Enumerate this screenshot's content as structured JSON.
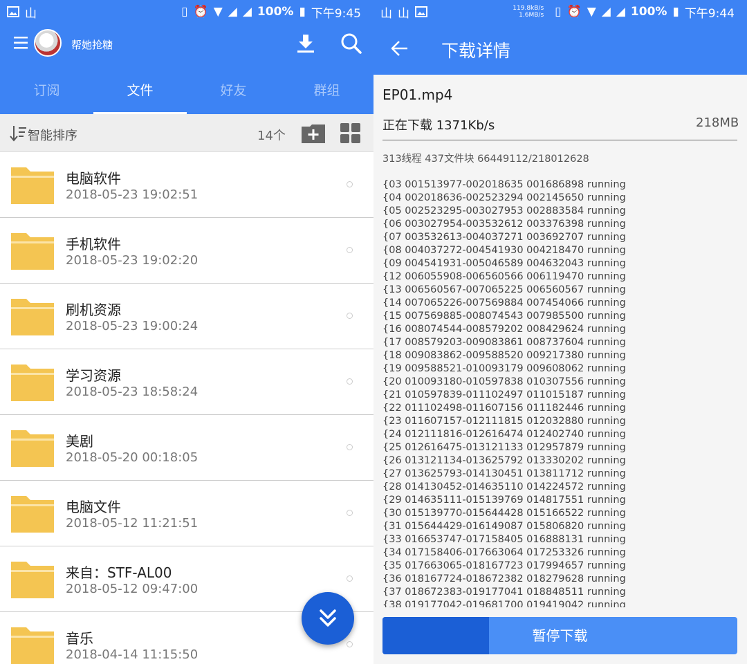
{
  "left": {
    "status": {
      "time": "下午9:45",
      "battery": "100%"
    },
    "user": {
      "name": "帮她抢糖"
    },
    "tabs": [
      {
        "label": "订阅"
      },
      {
        "label": "文件"
      },
      {
        "label": "好友"
      },
      {
        "label": "群组"
      }
    ],
    "sort": {
      "label": "智能排序",
      "count": "14个"
    },
    "files": [
      {
        "name": "电脑软件",
        "date": "2018-05-23 19:02:51"
      },
      {
        "name": "手机软件",
        "date": "2018-05-23 19:02:20"
      },
      {
        "name": "刷机资源",
        "date": "2018-05-23 19:00:24"
      },
      {
        "name": "学习资源",
        "date": "2018-05-23 18:58:24"
      },
      {
        "name": "美剧",
        "date": "2018-05-20 00:18:05"
      },
      {
        "name": "电脑文件",
        "date": "2018-05-12 11:21:51"
      },
      {
        "name": "来自：STF-AL00",
        "date": "2018-05-12 09:47:00"
      },
      {
        "name": "音乐",
        "date": "2018-04-14 11:15:50"
      }
    ],
    "accent": "#3d83f4",
    "folder_color": "#f4c552"
  },
  "right": {
    "status": {
      "net_up": "119.8kB/s",
      "net_down": "1.6MB/s",
      "battery": "100%",
      "time": "下午9:44"
    },
    "title": "下载详情",
    "file": "EP01.mp4",
    "speed": "正在下载 1371Kb/s",
    "size": "218MB",
    "threads": "313线程 437文件块 66449112/218012628",
    "log": [
      "{03 001513977-002018635 001686898 running",
      "{04 002018636-002523294 002145650 running",
      "{05 002523295-003027953 002883584 running",
      "{06 003027954-003532612 003376398 running",
      "{07 003532613-004037271 003692707 running",
      "{08 004037272-004541930 004218470 running",
      "{09 004541931-005046589 004632043 running",
      "{12 006055908-006560566 006119470 running",
      "{13 006560567-007065225 006560567 running",
      "{14 007065226-007569884 007454066 running",
      "{15 007569885-008074543 007985500 running",
      "{16 008074544-008579202 008429624 running",
      "{17 008579203-009083861 008737604 running",
      "{18 009083862-009588520 009217380 running",
      "{19 009588521-010093179 009608062 running",
      "{20 010093180-010597838 010307556 running",
      "{21 010597839-011102497 011015187 running",
      "{22 011102498-011607156 011182446 running",
      "{23 011607157-012111815 012032880 running",
      "{24 012111816-012616474 012402740 running",
      "{25 012616475-013121133 012957879 running",
      "{26 013121134-013625792 013330202 running",
      "{27 013625793-014130451 013811712 running",
      "{28 014130452-014635110 014224572 running",
      "{29 014635111-015139769 014817551 running",
      "{30 015139770-015644428 015166522 running",
      "{31 015644429-016149087 015806820 running",
      "{33 016653747-017158405 016888131 running",
      "{34 017158406-017663064 017253326 running",
      "{35 017663065-018167723 017994657 running",
      "{36 018167724-018672382 018279628 running",
      "{37 018672383-019177041 018848511 running",
      "{38 019177042-019681700 019419042 running"
    ],
    "progress_fraction": 0.3,
    "pause_label": "暂停下载"
  }
}
